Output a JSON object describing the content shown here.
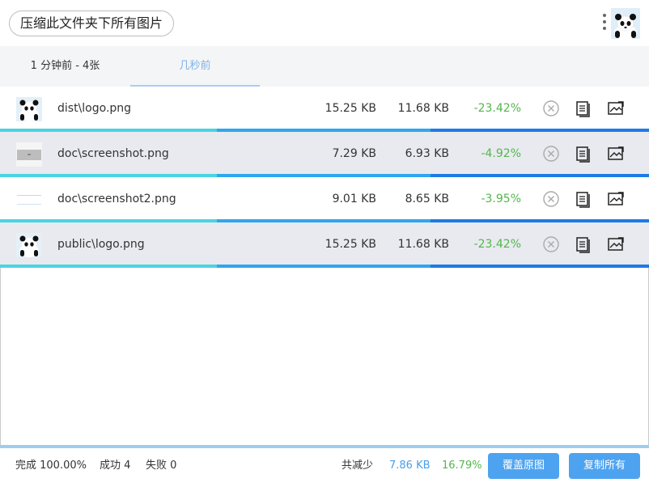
{
  "header": {
    "title": "压缩此文件夹下所有图片",
    "menu_icon": "more-vertical-icon",
    "avatar_icon": "panda-avatar-icon"
  },
  "tabs": [
    {
      "label": "1 分钟前 - 4张"
    },
    {
      "label": "几秒前"
    }
  ],
  "files": [
    {
      "name": "dist\\logo.png",
      "original": "15.25 KB",
      "compressed": "11.68 KB",
      "reduction": "-23.42%",
      "thumb": "panda-thumb"
    },
    {
      "name": "doc\\screenshot.png",
      "original": "7.29 KB",
      "compressed": "6.93 KB",
      "reduction": "-4.92%",
      "thumb": "screenshot-thumb"
    },
    {
      "name": "doc\\screenshot2.png",
      "original": "9.01 KB",
      "compressed": "8.65 KB",
      "reduction": "-3.95%",
      "thumb": "screenshot-thumb"
    },
    {
      "name": "public\\logo.png",
      "original": "15.25 KB",
      "compressed": "11.68 KB",
      "reduction": "-23.42%",
      "thumb": "panda-thumb"
    }
  ],
  "row_actions": {
    "remove_icon": "close-circle-icon",
    "copy_icon": "document-icon",
    "compare_icon": "image-compare-icon"
  },
  "footer": {
    "done": "完成 100.00%",
    "success": "成功 4",
    "fail": "失败 0",
    "reduce_label": "共减少",
    "reduce_size": "7.86 KB",
    "reduce_rate": "16.79%",
    "overwrite_label": "覆盖原图",
    "copy_all_label": "复制所有"
  },
  "colors": {
    "accent": "#4da3f0",
    "success": "#55b54d",
    "progress_cyan": "#4ad3e2",
    "progress_blue": "#1d7be6"
  }
}
